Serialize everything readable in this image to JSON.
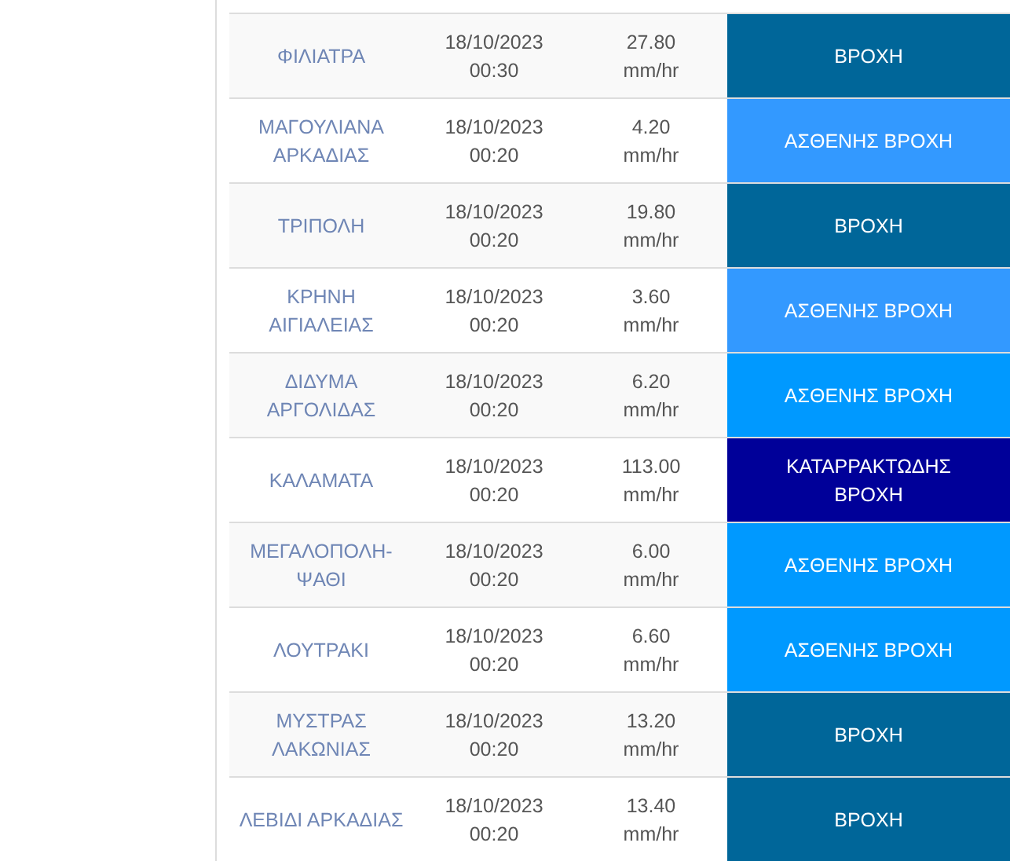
{
  "rows": [
    {
      "station": "ΦΙΛΙΑΤΡΑ",
      "date": "18/10/2023",
      "time": "00:30",
      "rate": "27.80",
      "unit": "mm/hr",
      "status": "ΒΡΟΧΗ",
      "color": "#006699"
    },
    {
      "station": "ΜΑΓΟΥΛΙΑΝΑ ΑΡΚΑΔΙΑΣ",
      "date": "18/10/2023",
      "time": "00:20",
      "rate": "4.20",
      "unit": "mm/hr",
      "status": "ΑΣΘΕΝΗΣ ΒΡΟΧΗ",
      "color": "#3399ff"
    },
    {
      "station": "ΤΡΙΠΟΛΗ",
      "date": "18/10/2023",
      "time": "00:20",
      "rate": "19.80",
      "unit": "mm/hr",
      "status": "ΒΡΟΧΗ",
      "color": "#006699"
    },
    {
      "station": "ΚΡΗΝΗ ΑΙΓΙΑΛΕΙΑΣ",
      "date": "18/10/2023",
      "time": "00:20",
      "rate": "3.60",
      "unit": "mm/hr",
      "status": "ΑΣΘΕΝΗΣ ΒΡΟΧΗ",
      "color": "#3399ff"
    },
    {
      "station": "ΔΙΔΥΜΑ ΑΡΓΟΛΙΔΑΣ",
      "date": "18/10/2023",
      "time": "00:20",
      "rate": "6.20",
      "unit": "mm/hr",
      "status": "ΑΣΘΕΝΗΣ ΒΡΟΧΗ",
      "color": "#0099ff"
    },
    {
      "station": "ΚΑΛΑΜΑΤΑ",
      "date": "18/10/2023",
      "time": "00:20",
      "rate": "113.00",
      "unit": "mm/hr",
      "status": "ΚΑΤΑΡΡΑΚΤΩΔΗΣ ΒΡΟΧΗ",
      "color": "#000099"
    },
    {
      "station": "ΜΕΓΑΛΟΠΟΛΗ-ΨΑΘΙ",
      "date": "18/10/2023",
      "time": "00:20",
      "rate": "6.00",
      "unit": "mm/hr",
      "status": "ΑΣΘΕΝΗΣ ΒΡΟΧΗ",
      "color": "#0099ff"
    },
    {
      "station": "ΛΟΥΤΡΑΚΙ",
      "date": "18/10/2023",
      "time": "00:20",
      "rate": "6.60",
      "unit": "mm/hr",
      "status": "ΑΣΘΕΝΗΣ ΒΡΟΧΗ",
      "color": "#0099ff"
    },
    {
      "station": "ΜΥΣΤΡΑΣ ΛΑΚΩΝΙΑΣ",
      "date": "18/10/2023",
      "time": "00:20",
      "rate": "13.20",
      "unit": "mm/hr",
      "status": "ΒΡΟΧΗ",
      "color": "#006699"
    },
    {
      "station": "ΛΕΒΙΔΙ ΑΡΚΑΔΙΑΣ",
      "date": "18/10/2023",
      "time": "00:20",
      "rate": "13.40",
      "unit": "mm/hr",
      "status": "ΒΡΟΧΗ",
      "color": "#006699"
    }
  ]
}
